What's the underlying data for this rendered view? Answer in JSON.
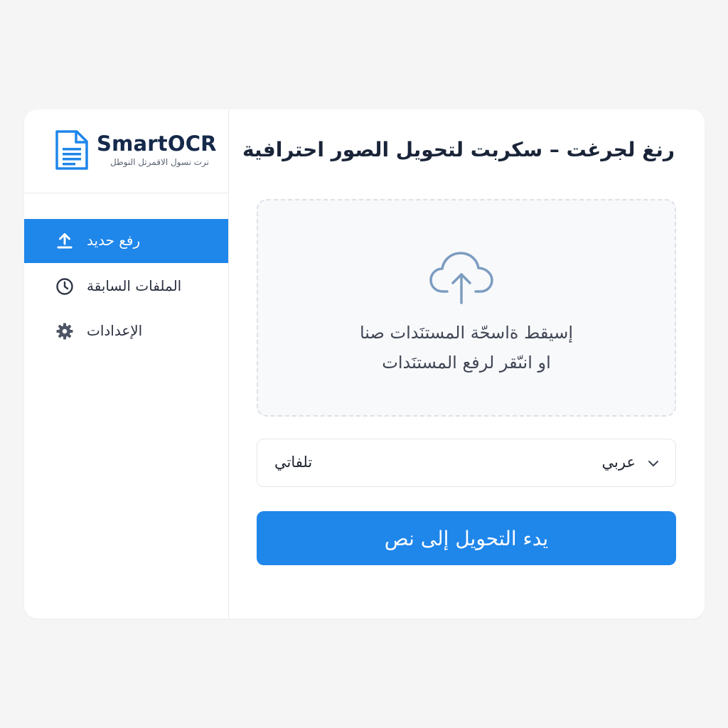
{
  "brand": {
    "name": "SmartOCR",
    "subtitle": "نرت نسول الاقمرتل النوطل",
    "logo_icon": "document-icon",
    "accent": "#1f86ea"
  },
  "sidebar": {
    "items": [
      {
        "label": "رفع حديد",
        "icon": "upload-icon",
        "active": true
      },
      {
        "label": "الملفات السابقة",
        "icon": "clock-icon",
        "active": false
      },
      {
        "label": "الإعدادات",
        "icon": "gear-icon",
        "active": false
      }
    ]
  },
  "main": {
    "title": "رنغ لجرغت – سكربت لتحويل الصور احترافية",
    "dropzone": {
      "icon": "cloud-upload-icon",
      "line1": "إسيقط ةاسحّة المستنَدات صنا",
      "line2": "او انىّقر لرفع المستنَدات"
    },
    "language_select": {
      "selected": "عربي",
      "secondary": "تلفاتي"
    },
    "convert_button": "يدء التحويل إلى نص"
  }
}
